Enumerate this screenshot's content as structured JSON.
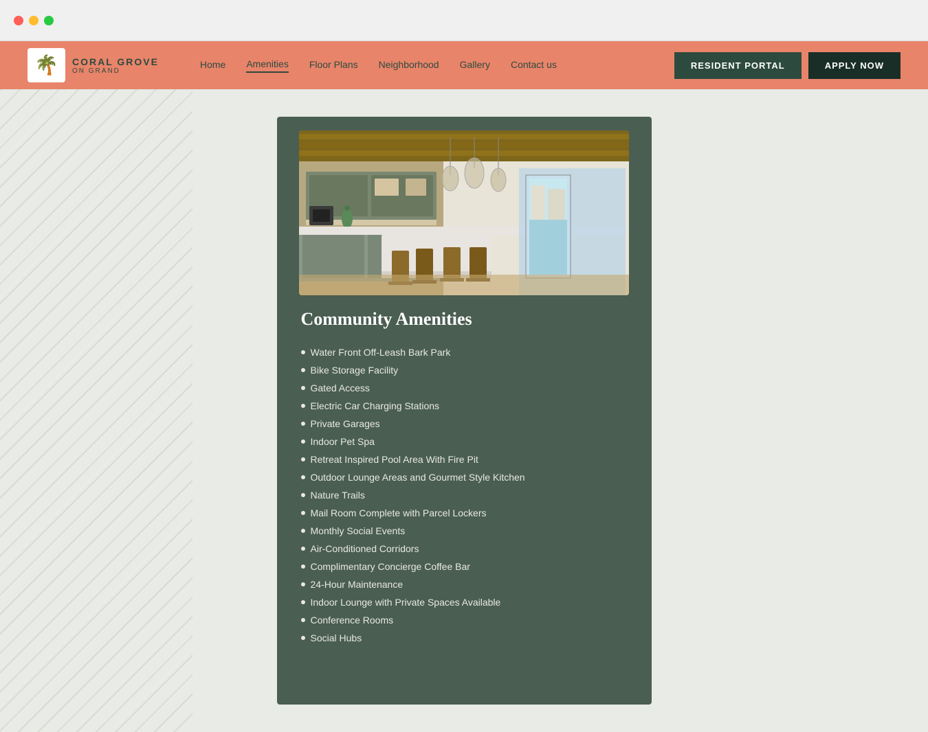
{
  "browser": {
    "dots": [
      "red",
      "yellow",
      "green"
    ]
  },
  "header": {
    "logo": {
      "icon": "🌴",
      "title": "CORAL GROVE",
      "subtitle": "ON GRAND"
    },
    "nav": [
      {
        "label": "Home",
        "active": false
      },
      {
        "label": "Amenities",
        "active": true
      },
      {
        "label": "Floor Plans",
        "active": false
      },
      {
        "label": "Neighborhood",
        "active": false
      },
      {
        "label": "Gallery",
        "active": false
      },
      {
        "label": "Contact us",
        "active": false
      }
    ],
    "buttons": {
      "portal": "RESIDENT PORTAL",
      "apply": "APPLY NOW"
    }
  },
  "main": {
    "section_title": "Community Amenities",
    "amenities": [
      "Water Front Off-Leash Bark Park",
      "Bike Storage Facility",
      "Gated Access",
      "Electric Car Charging Stations",
      "Private Garages",
      "Indoor Pet Spa",
      "Retreat Inspired Pool Area With Fire Pit",
      "Outdoor Lounge Areas and Gourmet Style Kitchen",
      "Nature Trails",
      "Mail Room Complete with Parcel Lockers",
      "Monthly Social Events",
      "Air-Conditioned Corridors",
      "Complimentary Concierge Coffee Bar",
      "24-Hour Maintenance",
      "Indoor Lounge with Private Spaces Available",
      "Conference Rooms",
      "Social Hubs"
    ]
  }
}
